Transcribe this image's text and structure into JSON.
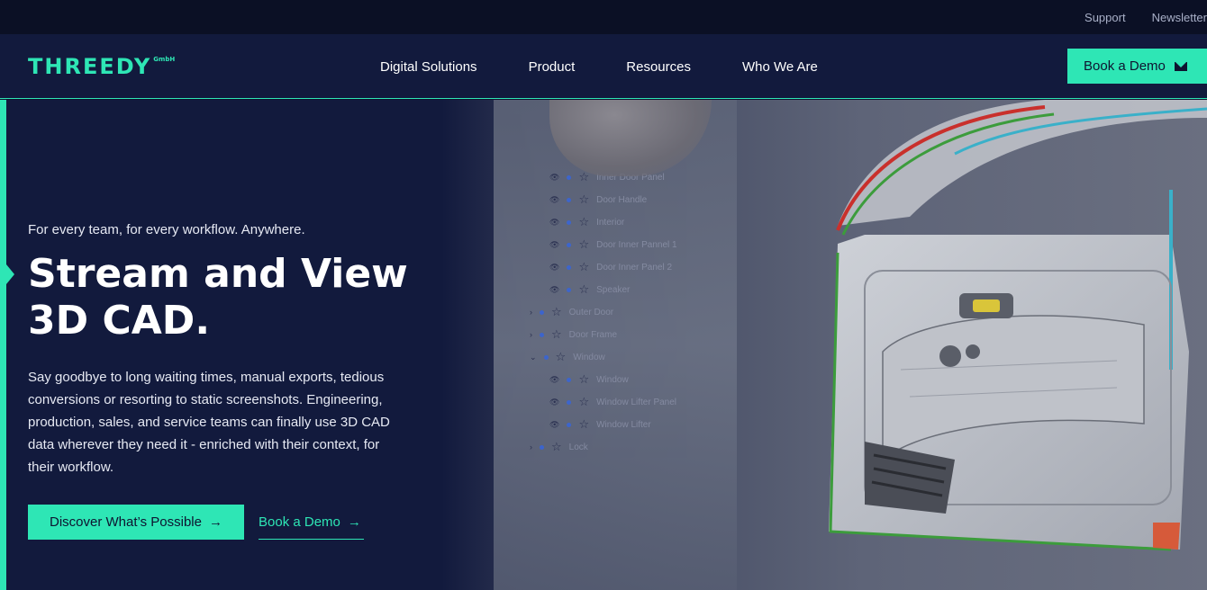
{
  "topbar": {
    "support": "Support",
    "newsletter": "Newsletter"
  },
  "nav": {
    "logo": "THREEDY",
    "logo_suffix": "GmbH",
    "items": [
      "Digital Solutions",
      "Product",
      "Resources",
      "Who We Are"
    ],
    "demo_label": "Book a Demo"
  },
  "hero": {
    "tagline": "For every team, for every workflow. Anywhere.",
    "headline_1": "Stream and View",
    "headline_2": "3D CAD.",
    "body": "Say goodbye to long waiting times, manual exports, tedious conversions or resorting to static screenshots. Engineering, production, sales, and service teams can finally use 3D CAD data wherever they need it - enriched with their context, for their workflow.",
    "cta_primary": "Discover What’s Possible",
    "cta_secondary": "Book a Demo",
    "arrow": "→"
  },
  "tree": {
    "items": [
      "Inner Door Panel",
      "Door Handle",
      "Interior",
      "Door Inner Pannel 1",
      "Door Inner Panel 2",
      "Speaker",
      "Outer Door",
      "Door Frame",
      "Window",
      "Window",
      "Window Lifter Panel",
      "Window Lifter",
      "Lock"
    ]
  },
  "colors": {
    "accent": "#2ee6b5",
    "navy": "#121a3d",
    "topbar": "#0b1025"
  }
}
